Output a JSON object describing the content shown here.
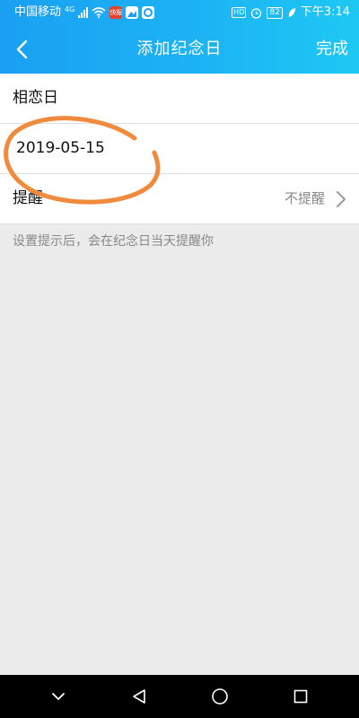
{
  "status_bar": {
    "carrier": "中国移动",
    "network": "4G",
    "app_badge": "快报",
    "hd": "HD",
    "battery": "82",
    "time": "下午3:14"
  },
  "nav": {
    "title": "添加纪念日",
    "done_label": "完成",
    "back_icon": "chevron-left-icon"
  },
  "form": {
    "name_label": "相恋日",
    "date_value": "2019-05-15",
    "remind_label": "提醒",
    "remind_value": "不提醒"
  },
  "hint": "设置提示后，会在纪念日当天提醒你",
  "annotation": {
    "color": "#f08a3c"
  },
  "colors": {
    "header_start": "#1aa0f2",
    "header_end": "#1ec8f3",
    "background": "#ebebeb"
  },
  "system_nav": [
    "collapse-icon",
    "back-icon",
    "home-icon",
    "recents-icon"
  ]
}
